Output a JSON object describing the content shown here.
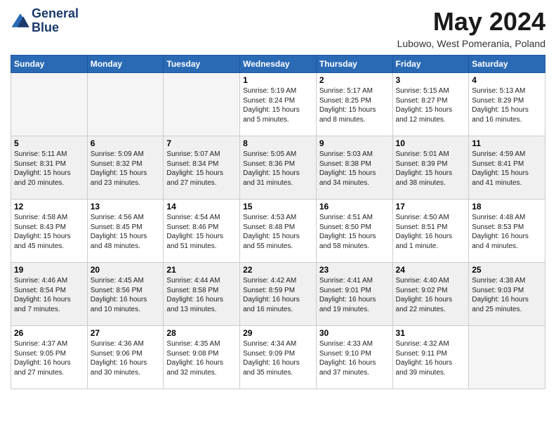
{
  "header": {
    "logo_line1": "General",
    "logo_line2": "Blue",
    "month_title": "May 2024",
    "location": "Lubowo, West Pomerania, Poland"
  },
  "days_of_week": [
    "Sunday",
    "Monday",
    "Tuesday",
    "Wednesday",
    "Thursday",
    "Friday",
    "Saturday"
  ],
  "weeks": [
    [
      {
        "day": "",
        "empty": true
      },
      {
        "day": "",
        "empty": true
      },
      {
        "day": "",
        "empty": true
      },
      {
        "day": "1",
        "sunrise": "5:19 AM",
        "sunset": "8:24 PM",
        "daylight": "15 hours and 5 minutes."
      },
      {
        "day": "2",
        "sunrise": "5:17 AM",
        "sunset": "8:25 PM",
        "daylight": "15 hours and 8 minutes."
      },
      {
        "day": "3",
        "sunrise": "5:15 AM",
        "sunset": "8:27 PM",
        "daylight": "15 hours and 12 minutes."
      },
      {
        "day": "4",
        "sunrise": "5:13 AM",
        "sunset": "8:29 PM",
        "daylight": "15 hours and 16 minutes."
      }
    ],
    [
      {
        "day": "5",
        "sunrise": "5:11 AM",
        "sunset": "8:31 PM",
        "daylight": "15 hours and 20 minutes."
      },
      {
        "day": "6",
        "sunrise": "5:09 AM",
        "sunset": "8:32 PM",
        "daylight": "15 hours and 23 minutes."
      },
      {
        "day": "7",
        "sunrise": "5:07 AM",
        "sunset": "8:34 PM",
        "daylight": "15 hours and 27 minutes."
      },
      {
        "day": "8",
        "sunrise": "5:05 AM",
        "sunset": "8:36 PM",
        "daylight": "15 hours and 31 minutes."
      },
      {
        "day": "9",
        "sunrise": "5:03 AM",
        "sunset": "8:38 PM",
        "daylight": "15 hours and 34 minutes."
      },
      {
        "day": "10",
        "sunrise": "5:01 AM",
        "sunset": "8:39 PM",
        "daylight": "15 hours and 38 minutes."
      },
      {
        "day": "11",
        "sunrise": "4:59 AM",
        "sunset": "8:41 PM",
        "daylight": "15 hours and 41 minutes."
      }
    ],
    [
      {
        "day": "12",
        "sunrise": "4:58 AM",
        "sunset": "8:43 PM",
        "daylight": "15 hours and 45 minutes."
      },
      {
        "day": "13",
        "sunrise": "4:56 AM",
        "sunset": "8:45 PM",
        "daylight": "15 hours and 48 minutes."
      },
      {
        "day": "14",
        "sunrise": "4:54 AM",
        "sunset": "8:46 PM",
        "daylight": "15 hours and 51 minutes."
      },
      {
        "day": "15",
        "sunrise": "4:53 AM",
        "sunset": "8:48 PM",
        "daylight": "15 hours and 55 minutes."
      },
      {
        "day": "16",
        "sunrise": "4:51 AM",
        "sunset": "8:50 PM",
        "daylight": "15 hours and 58 minutes."
      },
      {
        "day": "17",
        "sunrise": "4:50 AM",
        "sunset": "8:51 PM",
        "daylight": "16 hours and 1 minute."
      },
      {
        "day": "18",
        "sunrise": "4:48 AM",
        "sunset": "8:53 PM",
        "daylight": "16 hours and 4 minutes."
      }
    ],
    [
      {
        "day": "19",
        "sunrise": "4:46 AM",
        "sunset": "8:54 PM",
        "daylight": "16 hours and 7 minutes."
      },
      {
        "day": "20",
        "sunrise": "4:45 AM",
        "sunset": "8:56 PM",
        "daylight": "16 hours and 10 minutes."
      },
      {
        "day": "21",
        "sunrise": "4:44 AM",
        "sunset": "8:58 PM",
        "daylight": "16 hours and 13 minutes."
      },
      {
        "day": "22",
        "sunrise": "4:42 AM",
        "sunset": "8:59 PM",
        "daylight": "16 hours and 16 minutes."
      },
      {
        "day": "23",
        "sunrise": "4:41 AM",
        "sunset": "9:01 PM",
        "daylight": "16 hours and 19 minutes."
      },
      {
        "day": "24",
        "sunrise": "4:40 AM",
        "sunset": "9:02 PM",
        "daylight": "16 hours and 22 minutes."
      },
      {
        "day": "25",
        "sunrise": "4:38 AM",
        "sunset": "9:03 PM",
        "daylight": "16 hours and 25 minutes."
      }
    ],
    [
      {
        "day": "26",
        "sunrise": "4:37 AM",
        "sunset": "9:05 PM",
        "daylight": "16 hours and 27 minutes."
      },
      {
        "day": "27",
        "sunrise": "4:36 AM",
        "sunset": "9:06 PM",
        "daylight": "16 hours and 30 minutes."
      },
      {
        "day": "28",
        "sunrise": "4:35 AM",
        "sunset": "9:08 PM",
        "daylight": "16 hours and 32 minutes."
      },
      {
        "day": "29",
        "sunrise": "4:34 AM",
        "sunset": "9:09 PM",
        "daylight": "16 hours and 35 minutes."
      },
      {
        "day": "30",
        "sunrise": "4:33 AM",
        "sunset": "9:10 PM",
        "daylight": "16 hours and 37 minutes."
      },
      {
        "day": "31",
        "sunrise": "4:32 AM",
        "sunset": "9:11 PM",
        "daylight": "16 hours and 39 minutes."
      },
      {
        "day": "",
        "empty": true
      }
    ]
  ]
}
